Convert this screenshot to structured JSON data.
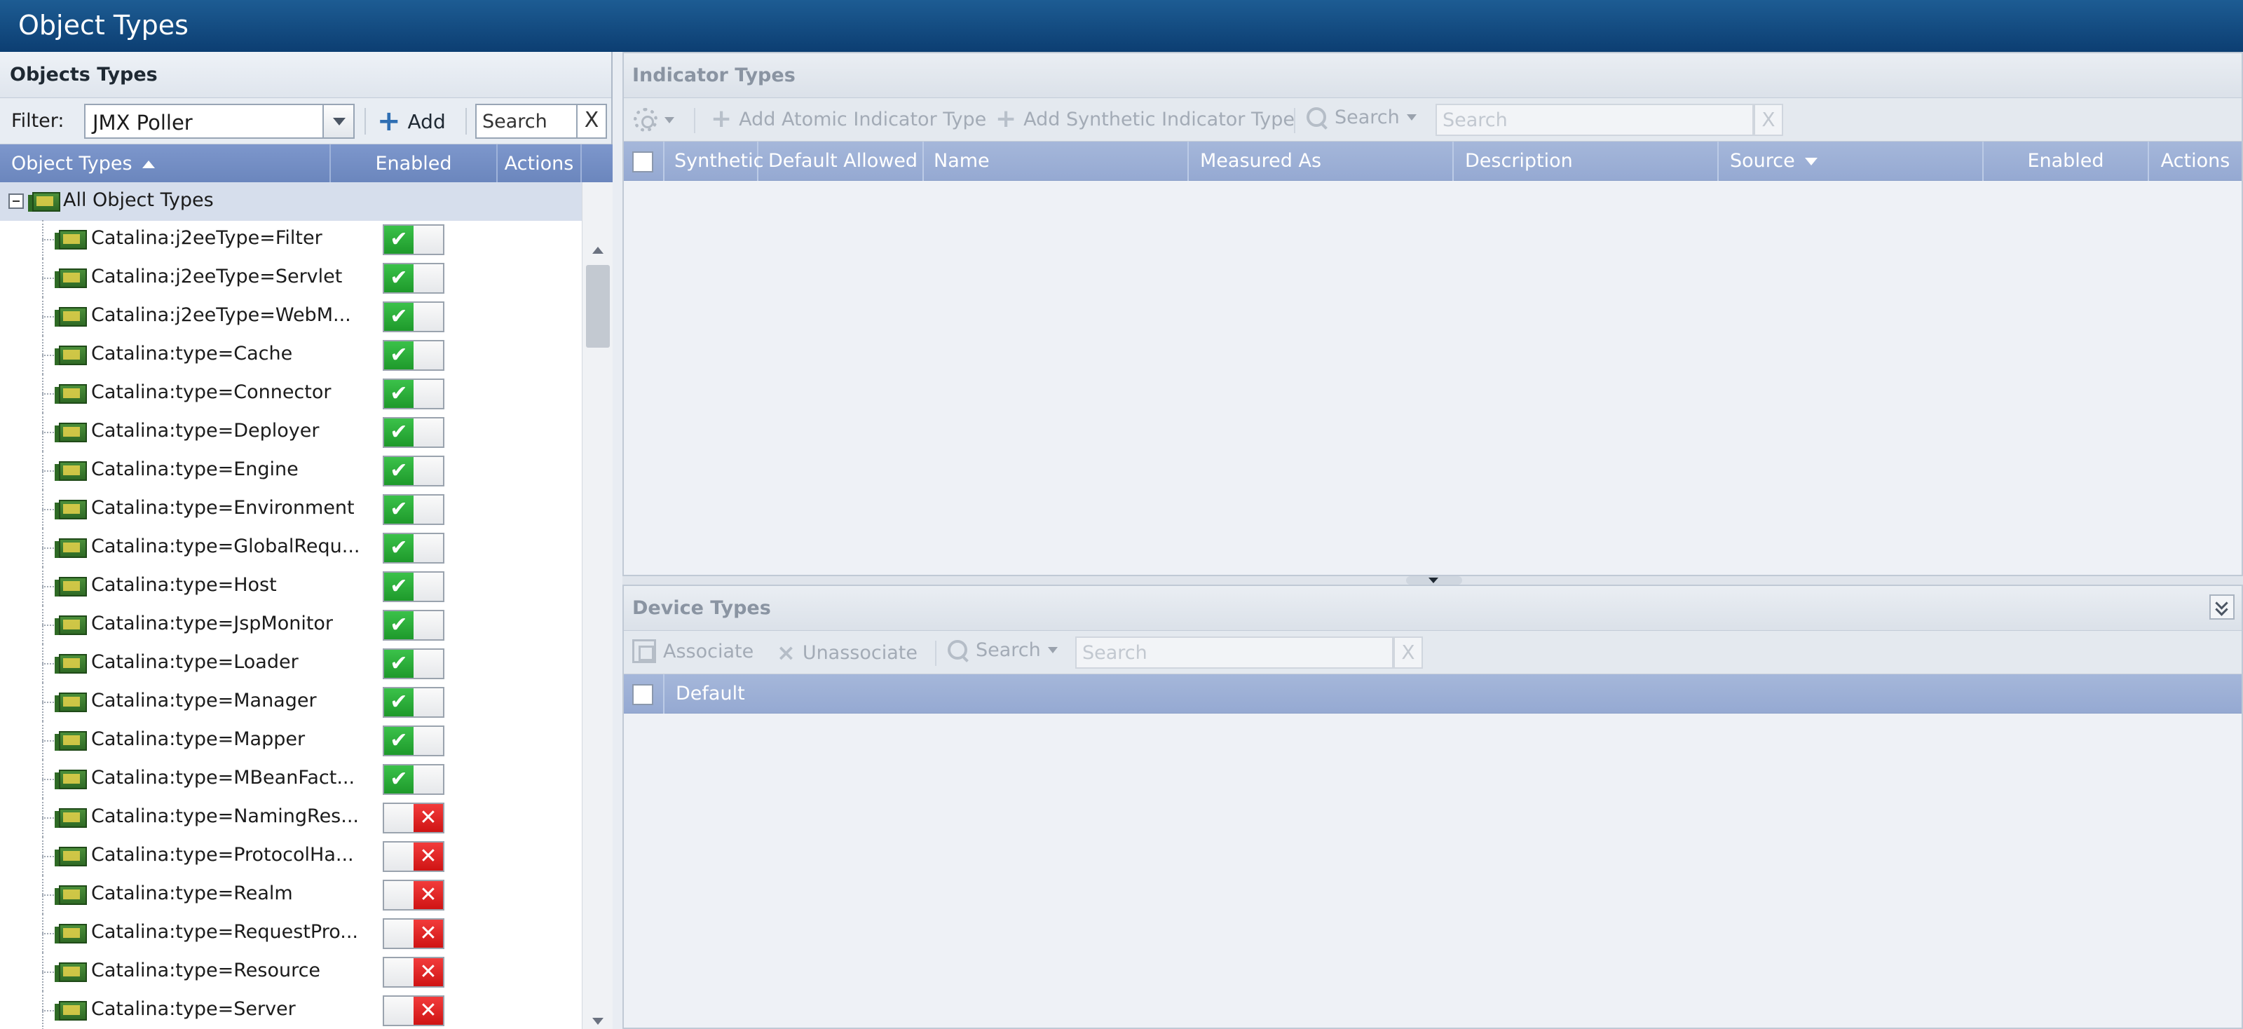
{
  "title": "Object Types",
  "left_panel": {
    "title": "Objects Types",
    "filter_label": "Filter:",
    "filter_value": "JMX Poller",
    "add_label": "Add",
    "search_placeholder": "Search",
    "search_clear": "X",
    "columns": [
      "Object Types",
      "Enabled",
      "Actions"
    ],
    "root_label": "All Object Types",
    "rows": [
      {
        "label": "Catalina:j2eeType=Filter",
        "enabled": true
      },
      {
        "label": "Catalina:j2eeType=Servlet",
        "enabled": true
      },
      {
        "label": "Catalina:j2eeType=WebM...",
        "enabled": true
      },
      {
        "label": "Catalina:type=Cache",
        "enabled": true
      },
      {
        "label": "Catalina:type=Connector",
        "enabled": true
      },
      {
        "label": "Catalina:type=Deployer",
        "enabled": true
      },
      {
        "label": "Catalina:type=Engine",
        "enabled": true
      },
      {
        "label": "Catalina:type=Environment",
        "enabled": true
      },
      {
        "label": "Catalina:type=GlobalRequ...",
        "enabled": true
      },
      {
        "label": "Catalina:type=Host",
        "enabled": true
      },
      {
        "label": "Catalina:type=JspMonitor",
        "enabled": true
      },
      {
        "label": "Catalina:type=Loader",
        "enabled": true
      },
      {
        "label": "Catalina:type=Manager",
        "enabled": true
      },
      {
        "label": "Catalina:type=Mapper",
        "enabled": true
      },
      {
        "label": "Catalina:type=MBeanFact...",
        "enabled": true
      },
      {
        "label": "Catalina:type=NamingRes...",
        "enabled": false
      },
      {
        "label": "Catalina:type=ProtocolHa...",
        "enabled": false
      },
      {
        "label": "Catalina:type=Realm",
        "enabled": false
      },
      {
        "label": "Catalina:type=RequestPro...",
        "enabled": false
      },
      {
        "label": "Catalina:type=Resource",
        "enabled": false
      },
      {
        "label": "Catalina:type=Server",
        "enabled": false
      }
    ]
  },
  "indicator_types": {
    "title": "Indicator Types",
    "toolbar": {
      "add_atomic": "Add Atomic Indicator Type",
      "add_synthetic": "Add Synthetic Indicator Type",
      "search_label": "Search",
      "search_placeholder": "Search",
      "search_clear": "X"
    },
    "columns": [
      "Synthetic",
      "Default Allowed",
      "Name",
      "Measured As",
      "Description",
      "Source",
      "Enabled",
      "Actions"
    ]
  },
  "device_types": {
    "title": "Device Types",
    "toolbar": {
      "associate": "Associate",
      "unassociate": "Unassociate",
      "search_label": "Search",
      "search_placeholder": "Search",
      "search_clear": "X"
    },
    "columns": [
      "Default"
    ]
  },
  "colors": {
    "titlebar": "#0c3e72",
    "grid_header": "#6b86bd",
    "enabled_on": "#1e9a2b",
    "enabled_off": "#cf1414"
  }
}
